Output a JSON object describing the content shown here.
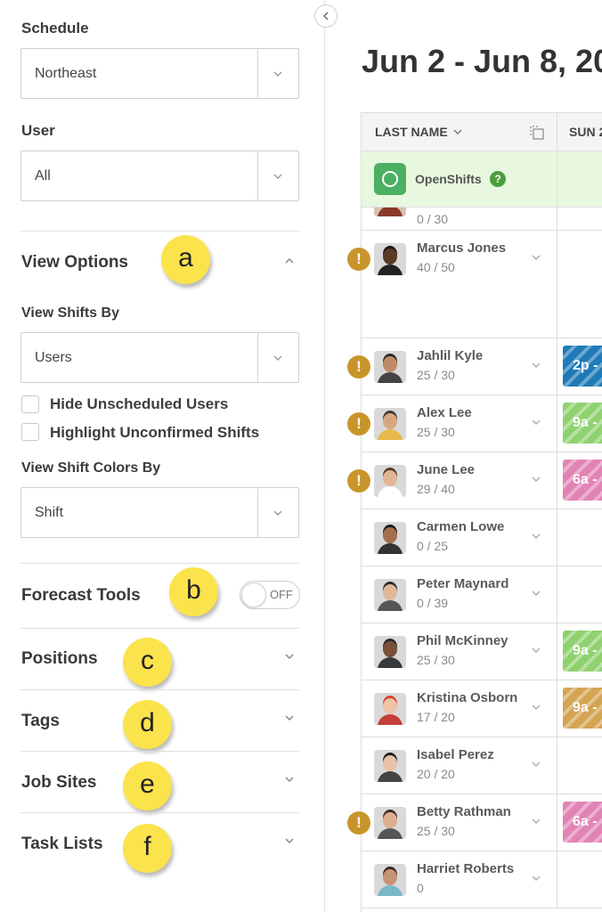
{
  "sidebar": {
    "schedule": {
      "label": "Schedule",
      "value": "Northeast"
    },
    "user": {
      "label": "User",
      "value": "All"
    },
    "view_options": {
      "title": "View Options",
      "badge": "a",
      "view_shifts_by": {
        "label": "View Shifts By",
        "value": "Users"
      },
      "checkboxes": [
        {
          "label": "Hide Unscheduled Users",
          "checked": false
        },
        {
          "label": "Highlight Unconfirmed Shifts",
          "checked": false
        }
      ],
      "view_shift_colors_by": {
        "label": "View Shift Colors By",
        "value": "Shift"
      }
    },
    "forecast_tools": {
      "title": "Forecast Tools",
      "badge": "b",
      "toggle": "OFF"
    },
    "sections": [
      {
        "title": "Positions",
        "badge": "c"
      },
      {
        "title": "Tags",
        "badge": "d"
      },
      {
        "title": "Job Sites",
        "badge": "e"
      },
      {
        "title": "Task Lists",
        "badge": "f"
      }
    ]
  },
  "main": {
    "date_range": "Jun 2 - Jun 8, 20",
    "columns": {
      "name": "LAST NAME",
      "day": "SUN 2"
    },
    "open_shifts": {
      "label": "OpenShifts",
      "help": "?"
    },
    "partial_row_hours": "0 / 30",
    "users": [
      {
        "name": "Marcus Jones",
        "hours": "40 / 50",
        "warning": true,
        "shift": null,
        "skin": "#5b3a26",
        "hair": "#1a1a1a",
        "shirt": "#222222"
      },
      {
        "name": "Jahlil Kyle",
        "hours": "25 / 30",
        "warning": true,
        "shift": {
          "text": "2p -",
          "color": "#1f7ab8"
        },
        "skin": "#c08a66",
        "hair": "#2a2a2a",
        "shirt": "#444444"
      },
      {
        "name": "Alex Lee",
        "hours": "25 / 30",
        "warning": true,
        "shift": {
          "text": "9a -",
          "color": "#8fd16f"
        },
        "skin": "#d9a77f",
        "hair": "#3a3a3a",
        "shirt": "#e8b84a"
      },
      {
        "name": "June Lee",
        "hours": "29 / 40",
        "warning": true,
        "shift": {
          "text": "6a -",
          "color": "#e184b5"
        },
        "skin": "#e2b594",
        "hair": "#5a3a28",
        "shirt": "#ffffff"
      },
      {
        "name": "Carmen Lowe",
        "hours": "0 / 25",
        "warning": false,
        "shift": null,
        "skin": "#a56e4d",
        "hair": "#1a1a1a",
        "shirt": "#333333"
      },
      {
        "name": "Peter Maynard",
        "hours": "0 / 39",
        "warning": false,
        "shift": null,
        "skin": "#e0b89a",
        "hair": "#2a2a2a",
        "shirt": "#555555"
      },
      {
        "name": "Phil McKinney",
        "hours": "25 / 30",
        "warning": false,
        "shift": {
          "text": "9a -",
          "color": "#8fd16f"
        },
        "skin": "#7a5038",
        "hair": "#2a2a2a",
        "shirt": "#3a3a3a"
      },
      {
        "name": "Kristina Osborn",
        "hours": "17 / 20",
        "warning": false,
        "shift": {
          "text": "9a -",
          "color": "#d4a452"
        },
        "skin": "#f0c2a8",
        "hair": "#d8432e",
        "shirt": "#c4403a"
      },
      {
        "name": "Isabel Perez",
        "hours": "20 / 20",
        "warning": false,
        "shift": null,
        "skin": "#e6c3a8",
        "hair": "#1f1a18",
        "shirt": "#444444"
      },
      {
        "name": "Betty Rathman",
        "hours": "25 / 30",
        "warning": true,
        "shift": {
          "text": "6a -",
          "color": "#e184b5"
        },
        "skin": "#dcae8f",
        "hair": "#3b2a22",
        "shirt": "#555555"
      },
      {
        "name": "Harriet Roberts",
        "hours": "0",
        "warning": false,
        "shift": null,
        "skin": "#c79474",
        "hair": "#3a2a20",
        "shirt": "#7ab8c8"
      }
    ]
  },
  "colors": {
    "badge": "#fbe34c",
    "warning": "#c9952b",
    "open_shift_bg": "#e7f8df",
    "open_shift_icon": "#4caf64"
  }
}
